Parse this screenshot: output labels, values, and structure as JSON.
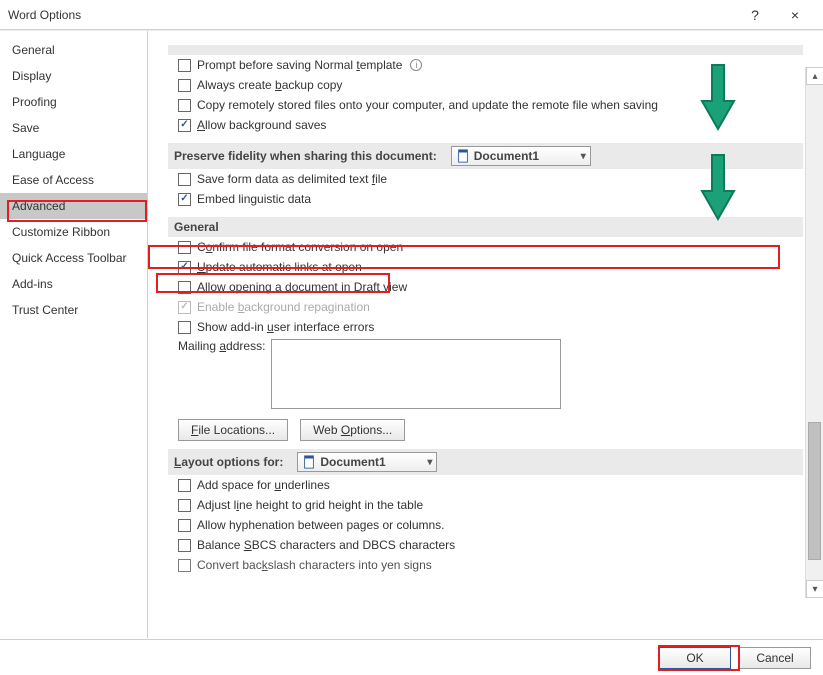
{
  "window": {
    "title": "Word Options",
    "help": "?",
    "close": "×"
  },
  "sidebar": {
    "items": [
      {
        "label": "General"
      },
      {
        "label": "Display"
      },
      {
        "label": "Proofing"
      },
      {
        "label": "Save"
      },
      {
        "label": "Language"
      },
      {
        "label": "Ease of Access"
      },
      {
        "label": "Advanced",
        "selected": true
      },
      {
        "label": "Customize Ribbon"
      },
      {
        "label": "Quick Access Toolbar"
      },
      {
        "label": "Add-ins"
      },
      {
        "label": "Trust Center"
      }
    ]
  },
  "save_section": {
    "items": [
      {
        "pre": "Prompt before saving Normal "
      },
      {
        "pre": "Always create "
      },
      {
        "pre": "Copy remotely stored files onto your computer, and update the remote file when saving"
      },
      {
        "pre": ""
      }
    ],
    "tmpl_u": "t",
    "tmpl_post": "emplate",
    "backup_u": "b",
    "backup_post": "ackup copy",
    "allow_u": "A",
    "allow_post": "llow background saves"
  },
  "preserve": {
    "title": "Preserve fidelity when sharing this document:",
    "doc": "Document1",
    "items": [
      {
        "pre": "Save form data as delimited text ",
        "u": "f",
        "post": "ile"
      },
      {
        "pre": "Embed linguistic data",
        "u": "",
        "post": ""
      }
    ]
  },
  "general": {
    "title": "General",
    "confirm_pre": "C",
    "confirm_u": "o",
    "confirm_post": "nfirm file format conversion on open",
    "update_pre": "",
    "update_u": "U",
    "update_post": "pdate automatic links at open",
    "draft_pre": "Allow opening a document in ",
    "draft_u": "D",
    "draft_post": "raft view",
    "repag_pre": "Enable ",
    "repag_u": "b",
    "repag_post": "ackground repagination",
    "addin_pre": "Show add-in ",
    "addin_u": "u",
    "addin_post": "ser interface errors",
    "mail_pre": "Mailing ",
    "mail_u": "a",
    "mail_post": "ddress:",
    "file_loc_pre": "",
    "file_loc_u": "F",
    "file_loc_post": "ile Locations...",
    "web_pre": "Web ",
    "web_u": "O",
    "web_post": "ptions..."
  },
  "layout": {
    "title_pre": "",
    "title_u": "L",
    "title_post": "ayout options for:",
    "doc": "Document1",
    "items": [
      {
        "pre": "Add space for ",
        "u": "u",
        "post": "nderlines"
      },
      {
        "pre": "Adjust l",
        "u": "i",
        "post": "ne height to grid height in the table"
      },
      {
        "pre": "Allow hyphenation between pa",
        "u": "g",
        "post": "es or columns."
      },
      {
        "pre": "Balance ",
        "u": "S",
        "post": "BCS characters and DBCS characters"
      },
      {
        "pre": "Convert bac",
        "u": "k",
        "post": "slash characters into yen signs"
      }
    ]
  },
  "footer": {
    "ok": "OK",
    "cancel": "Cancel"
  }
}
